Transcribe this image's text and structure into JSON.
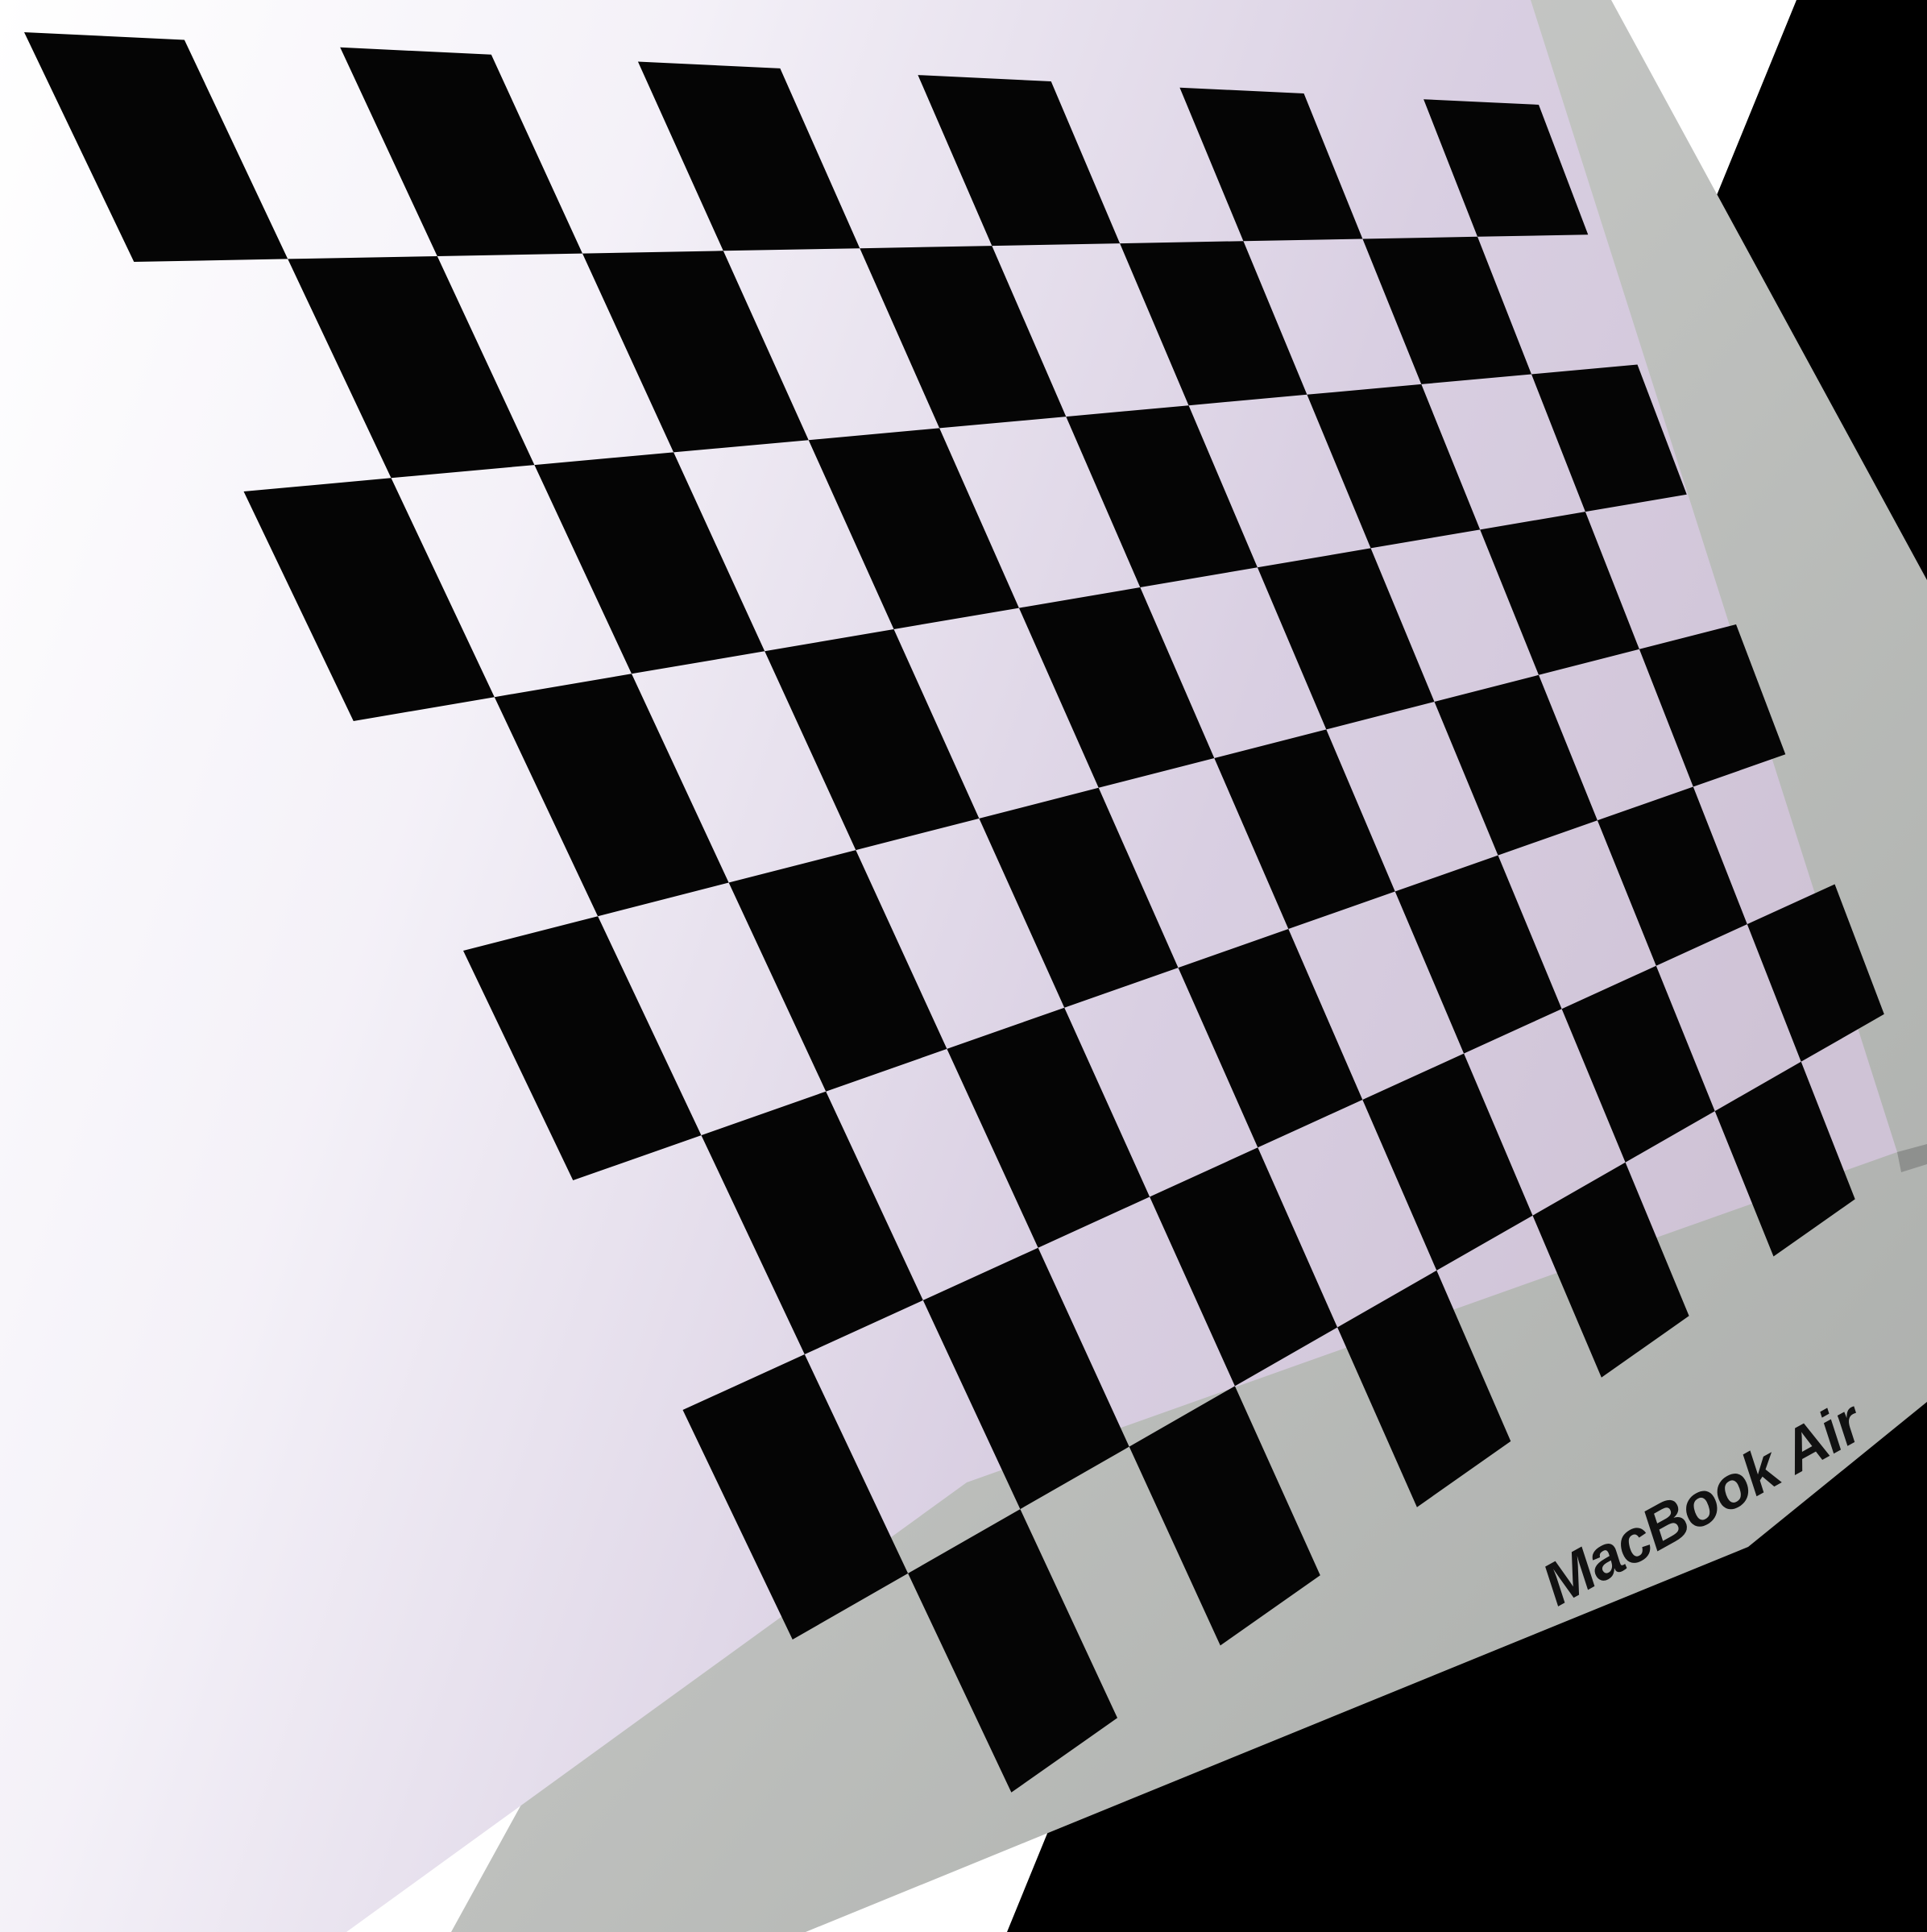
{
  "photo": {
    "subject": "checkerboard",
    "brand_label": "MacBook Air",
    "board": {
      "rows": 8,
      "cols": 11
    },
    "colors": {
      "dark_square": "#050505",
      "light_square": "#ddd6e6",
      "bezel": "#c2c4c2",
      "background": "#ffffff",
      "shadow": "#000000"
    }
  }
}
